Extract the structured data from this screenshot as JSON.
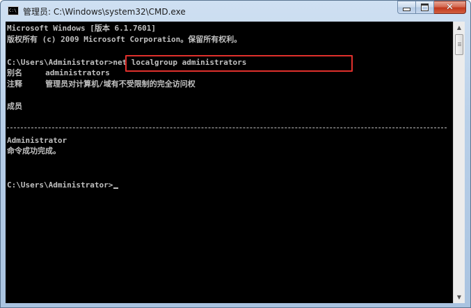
{
  "window": {
    "title": "管理员: C:\\Windows\\system32\\CMD.exe",
    "icon_label": "C:\\",
    "minimize_icon": "minimize-icon",
    "maximize_icon": "maximize-icon",
    "close_icon": "close-icon"
  },
  "console": {
    "lines": [
      "Microsoft Windows [版本 6.1.7601]",
      "版权所有 (c) 2009 Microsoft Corporation。保留所有权利。",
      "C:\\Users\\Administrator>net localgroup administrators",
      "别名     administrators",
      "注释     管理员对计算机/域有不受限制的完全访问权",
      "成员",
      "Administrator",
      "命令成功完成。",
      "C:\\Users\\Administrator>"
    ],
    "separator": "-------------------------------------------------------------------------------",
    "highlighted_command": "net localgroup administrators"
  },
  "colors": {
    "console_bg": "#000000",
    "console_text": "#c0c0c0",
    "highlight_border": "#e0302c"
  }
}
